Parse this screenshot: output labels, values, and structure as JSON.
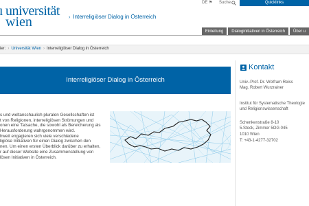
{
  "header": {
    "logo_line1": "universität",
    "logo_line2": "wien",
    "site_title": "Interreligiöser Dialog in Österreich",
    "lang": "DE",
    "search_label": "Suche",
    "quicklinks_label": "Quicklinks"
  },
  "nav": {
    "items": [
      {
        "label": "Einleitung"
      },
      {
        "label": "Dialoginitiativen in Österreich"
      },
      {
        "label": "Über u"
      }
    ]
  },
  "breadcrumb": {
    "prefix": "ier:",
    "items": [
      "Universität Wien",
      "Interreligiöser Dialog in Österreich"
    ]
  },
  "main": {
    "banner_title": "Interreligiöser Dialog in Österreich",
    "intro_lines": [
      "s und weltanschaulich pluralen Gesellschaften ist",
      "t von Religionen, interreligiösen Strömungen und",
      "onen eine Tatsache, die sowohl als Bereicherung als",
      "Herausforderung wahrgenommen wird.",
      "hweit engagieren sich viele verschiedene",
      "ligiöse Initiativen für einen Dialog zwischen den",
      "nen. Um einen ersten Überblick darüber zu erhalten,",
      "r auf dieser Website eine Zusammenstellung von",
      "lösen Initiativen in Österreich."
    ]
  },
  "sidebar": {
    "title": "Kontakt",
    "lines": [
      "Univ.-Prof. Dr. Wolfram Reiss",
      "Mag. Robert Wurzrainer",
      "",
      "Institut für Systematische Theologie",
      "und Religionswissenschaft",
      "",
      "Schenkenstraße 8-10",
      "5.Stock, Zimmer 5OG 045",
      "1010 Wien",
      "T: +43-1-4277-32702"
    ]
  },
  "colors": {
    "brand": "#0063a6",
    "nav_bg": "#666666"
  }
}
